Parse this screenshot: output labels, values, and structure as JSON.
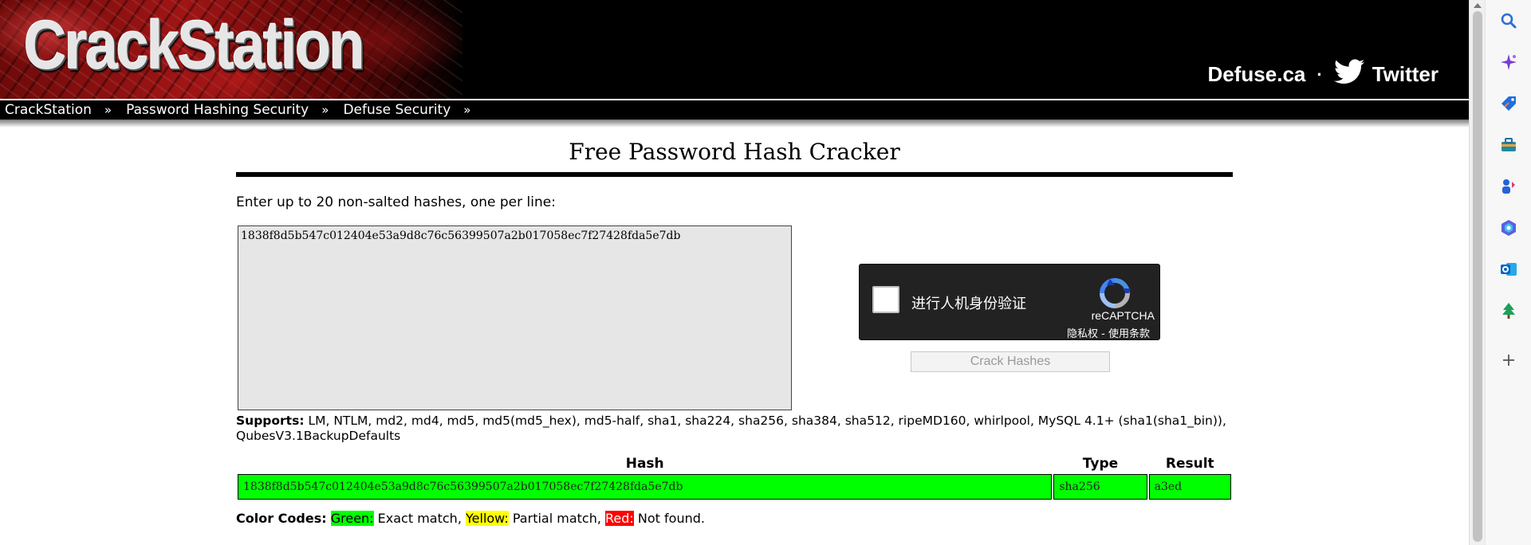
{
  "header": {
    "logo": "CrackStation",
    "links": {
      "defuse": "Defuse.ca",
      "separator": "·",
      "twitter": "Twitter"
    }
  },
  "nav": {
    "items": [
      {
        "label": "CrackStation"
      },
      {
        "label": "Password Hashing Security"
      },
      {
        "label": "Defuse Security"
      }
    ],
    "chevron": "»"
  },
  "main": {
    "title": "Free Password Hash Cracker",
    "intro": "Enter up to 20 non-salted hashes, one per line:",
    "hash_input_value": "1838f8d5b547c012404e53a9d8c76c56399507a2b017058ec7f27428fda5e7db",
    "captcha": {
      "label": "进行人机身份验证",
      "brand": "reCAPTCHA",
      "terms": "隐私权 - 使用条款"
    },
    "crack_button": "Crack Hashes",
    "supports": {
      "label": "Supports:",
      "text": "LM, NTLM, md2, md4, md5, md5(md5_hex), md5-half, sha1, sha224, sha256, sha384, sha512, ripeMD160, whirlpool, MySQL 4.1+ (sha1(sha1_bin)), QubesV3.1BackupDefaults"
    },
    "results": {
      "columns": [
        "Hash",
        "Type",
        "Result"
      ],
      "rows": [
        {
          "hash": "1838f8d5b547c012404e53a9d8c76c56399507a2b017058ec7f27428fda5e7db",
          "type": "sha256",
          "result": "a3ed"
        }
      ],
      "row_color": "#00ff00"
    },
    "color_codes": {
      "label": "Color Codes:",
      "green": "Green:",
      "green_text": "Exact match,",
      "yellow": "Yellow:",
      "yellow_text": "Partial match,",
      "red": "Red:",
      "red_text": "Not found."
    }
  },
  "colors": {
    "green": "#00ff00",
    "yellow": "#ffff00",
    "red": "#ff0000",
    "header_bg": "#000000"
  },
  "siderail": {
    "icons": [
      "search-icon",
      "copilot-sparkle-icon",
      "shopping-tag-icon",
      "toolbox-icon",
      "games-icon",
      "microsoft365-icon",
      "outlook-icon",
      "tree-icon",
      "add-icon"
    ]
  }
}
